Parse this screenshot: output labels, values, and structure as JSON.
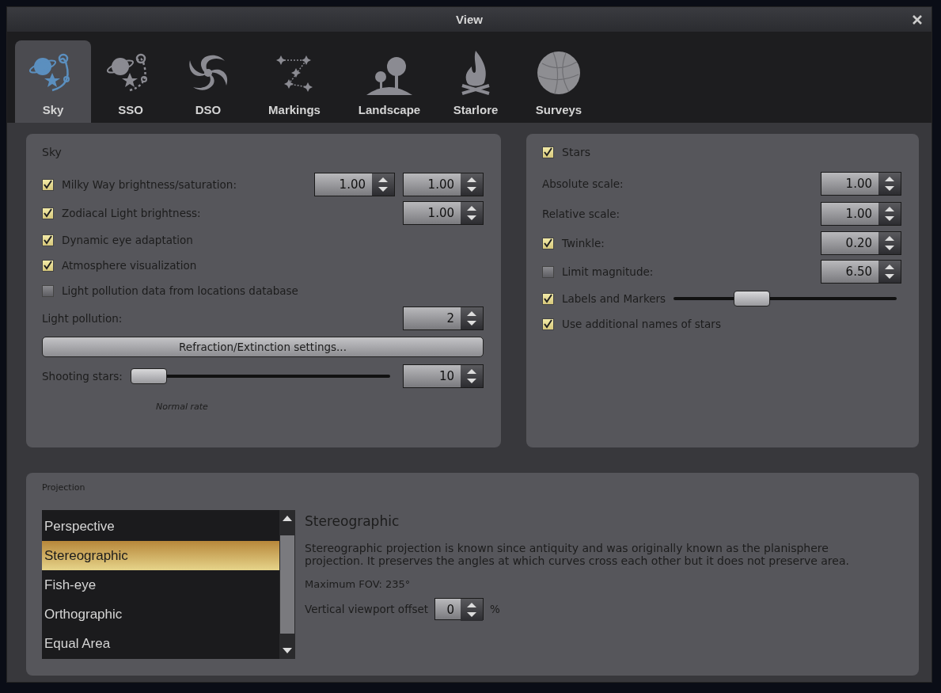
{
  "window": {
    "title": "View"
  },
  "tabs": [
    {
      "label": "Sky",
      "selected": true
    },
    {
      "label": "SSO",
      "selected": false
    },
    {
      "label": "DSO",
      "selected": false
    },
    {
      "label": "Markings",
      "selected": false
    },
    {
      "label": "Landscape",
      "selected": false
    },
    {
      "label": "Starlore",
      "selected": false
    },
    {
      "label": "Surveys",
      "selected": false
    }
  ],
  "sky_panel": {
    "title": "Sky",
    "rows": [
      {
        "kind": "check",
        "label": "Milky Way brightness/saturation:",
        "checked": true,
        "spinboxes": [
          "1.00",
          "1.00"
        ]
      },
      {
        "kind": "check",
        "label": "Zodiacal Light brightness:",
        "checked": true,
        "spinboxes": [
          "1.00"
        ]
      },
      {
        "kind": "check",
        "label": "Dynamic eye adaptation",
        "checked": true
      },
      {
        "kind": "check",
        "label": "Atmosphere visualization",
        "checked": true
      },
      {
        "kind": "check",
        "label": "Light pollution data from locations database",
        "checked": false
      },
      {
        "kind": "plain",
        "label": "Light pollution:",
        "spinboxes": [
          "2"
        ]
      },
      {
        "kind": "button",
        "label": "Refraction/Extinction settings..."
      },
      {
        "kind": "slider",
        "label": "Shooting stars:",
        "level": 0.0,
        "spinboxes": [
          "10"
        ],
        "caption": "Normal rate"
      }
    ]
  },
  "stars_panel": {
    "title": "Stars",
    "checked": true,
    "rows": [
      {
        "kind": "plain",
        "label": "Absolute scale:",
        "spinboxes": [
          "1.00"
        ]
      },
      {
        "kind": "plain",
        "label": "Relative scale:",
        "spinboxes": [
          "1.00"
        ]
      },
      {
        "kind": "check",
        "label": "Twinkle:",
        "checked": true,
        "spinboxes": [
          "0.20"
        ]
      },
      {
        "kind": "check",
        "label": "Limit magnitude:",
        "checked": false,
        "spinboxes": [
          "6.50"
        ]
      },
      {
        "kind": "checkslider",
        "label": "Labels and Markers",
        "checked": true,
        "level": 0.32
      },
      {
        "kind": "check",
        "label": "Use additional names of stars",
        "checked": true
      }
    ]
  },
  "projection": {
    "title": "Projection",
    "items": [
      {
        "label": "Perspective",
        "selected": false
      },
      {
        "label": "Stereographic",
        "selected": true
      },
      {
        "label": "Fish-eye",
        "selected": false
      },
      {
        "label": "Orthographic",
        "selected": false
      },
      {
        "label": "Equal Area",
        "selected": false
      }
    ],
    "name": "Stereographic",
    "description": "Stereographic projection is known since antiquity and was originally known as the planisphere projection. It preserves the angles at which curves cross each other but it does not preserve area.",
    "max_fov": "Maximum FOV: 235°",
    "offset": {
      "label": "Vertical viewport offset",
      "value": "0",
      "unit": "%"
    }
  }
}
